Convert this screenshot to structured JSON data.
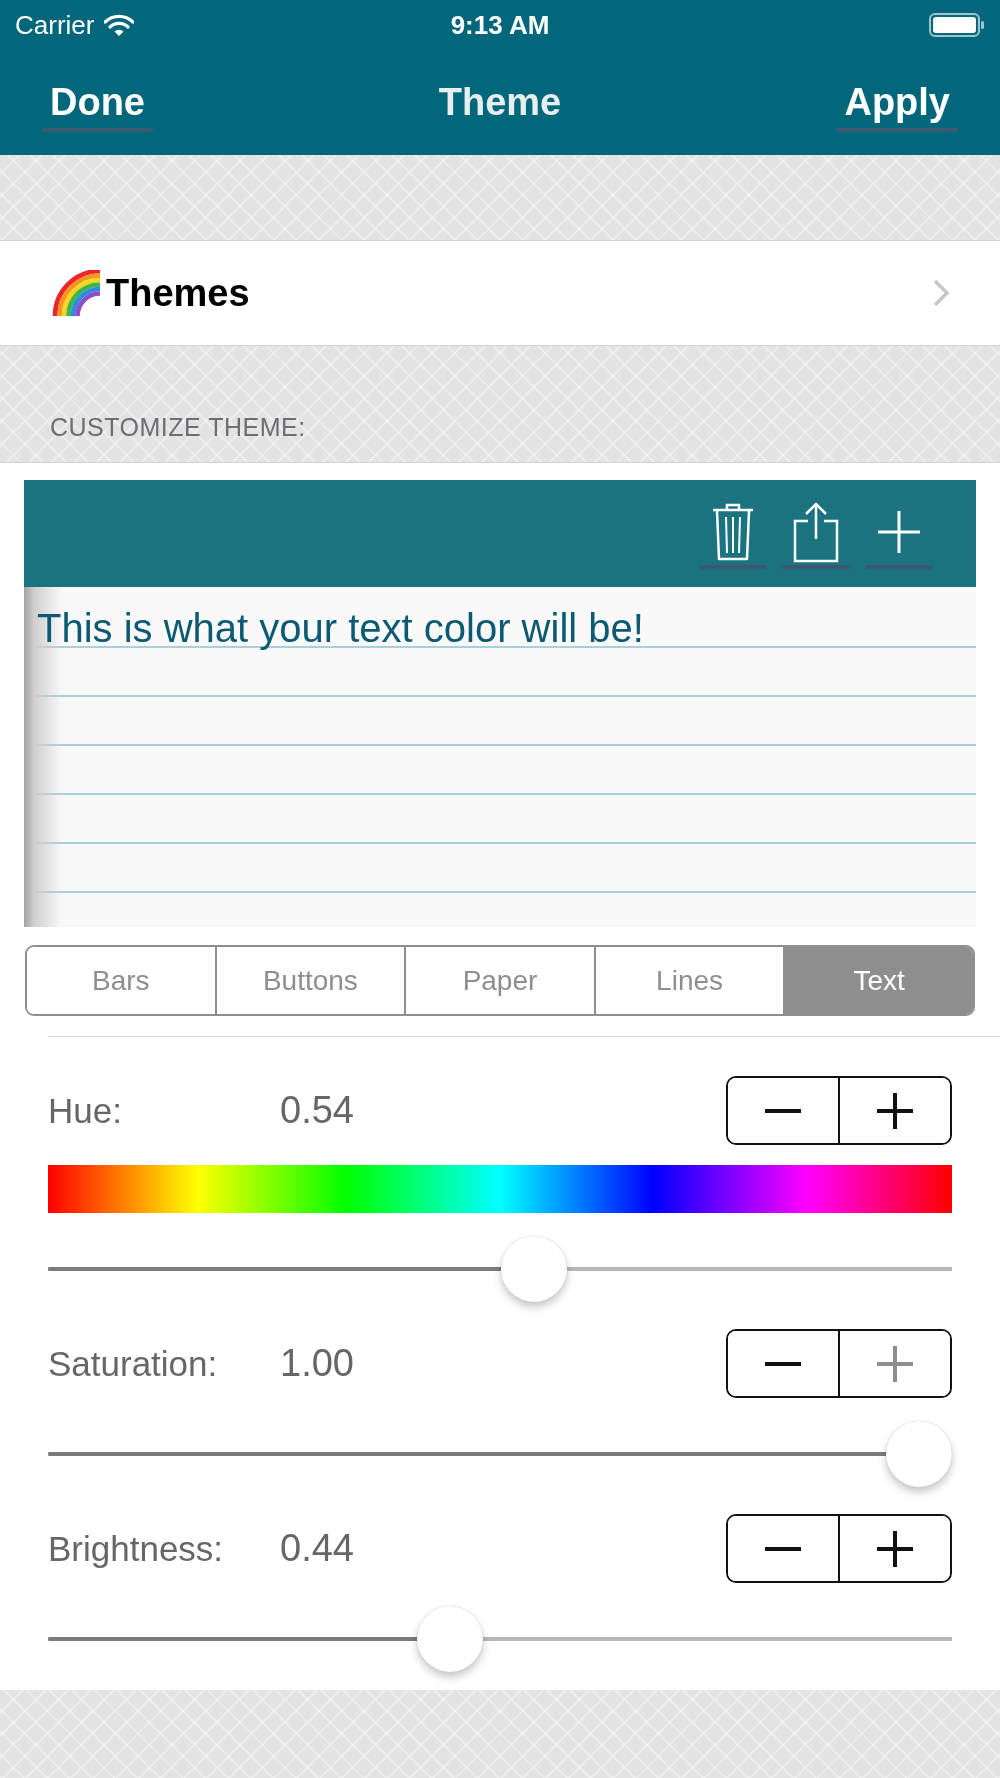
{
  "status_bar": {
    "carrier": "Carrier",
    "time": "9:13 AM"
  },
  "nav_bar": {
    "left_button": "Done",
    "title": "Theme",
    "right_button": "Apply"
  },
  "themes_row": {
    "label": "Themes"
  },
  "section_header": "CUSTOMIZE THEME:",
  "preview": {
    "sample_text": "This is what your text color will be!"
  },
  "segments": [
    {
      "label": "Bars",
      "selected": false
    },
    {
      "label": "Buttons",
      "selected": false
    },
    {
      "label": "Paper",
      "selected": false
    },
    {
      "label": "Lines",
      "selected": false
    },
    {
      "label": "Text",
      "selected": true
    }
  ],
  "sliders": [
    {
      "kind": "spectrum",
      "label": "Hue:",
      "reading": "0.54",
      "level": 0.54,
      "decrease_disabled": false,
      "increase_disabled": false
    },
    {
      "kind": "plain",
      "label": "Saturation:",
      "reading": "1.00",
      "level": 1.0,
      "decrease_disabled": false,
      "increase_disabled": true
    },
    {
      "kind": "plain",
      "label": "Brightness:",
      "reading": "0.44",
      "level": 0.44,
      "decrease_disabled": false,
      "increase_disabled": false
    }
  ]
}
